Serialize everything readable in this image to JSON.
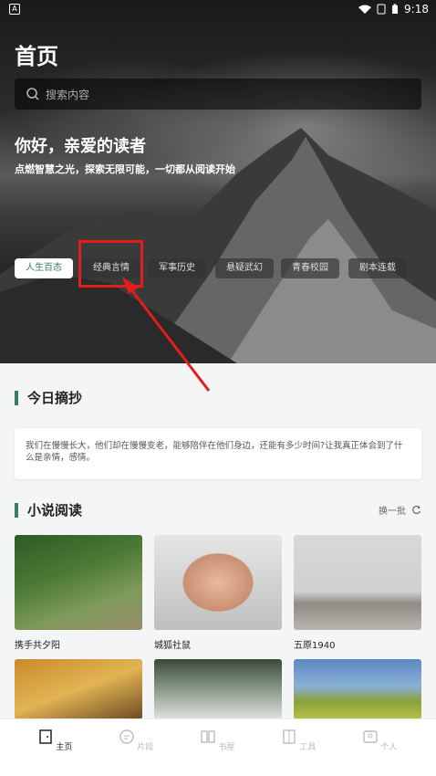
{
  "status": {
    "time": "9:18"
  },
  "header": {
    "title": "首页"
  },
  "search": {
    "placeholder": "搜索内容"
  },
  "hero": {
    "greeting": "你好，亲爱的读者",
    "subtitle": "点燃智慧之光，探索无限可能，一切都从阅读开始"
  },
  "categories": [
    "人生百态",
    "经典言情",
    "军事历史",
    "悬疑武幻",
    "青春校园",
    "剧本连载"
  ],
  "today": {
    "title": "今日摘抄",
    "text": "我们在慢慢长大，他们却在慢慢变老，能够陪伴在他们身边，还能有多少时间?让我真正体会到了什么是亲情，感情。"
  },
  "novels": {
    "title": "小说阅读",
    "refresh_label": "换一批",
    "books": [
      {
        "name": "携手共夕阳"
      },
      {
        "name": "城狐社鼠"
      },
      {
        "name": "五原1940"
      },
      {
        "name": ""
      },
      {
        "name": ""
      },
      {
        "name": ""
      }
    ]
  },
  "nav": [
    "主页",
    "片段",
    "书屋",
    "工具",
    "个人"
  ],
  "colors": {
    "accent": "#3a7d5a",
    "highlight": "#e31c1c"
  }
}
